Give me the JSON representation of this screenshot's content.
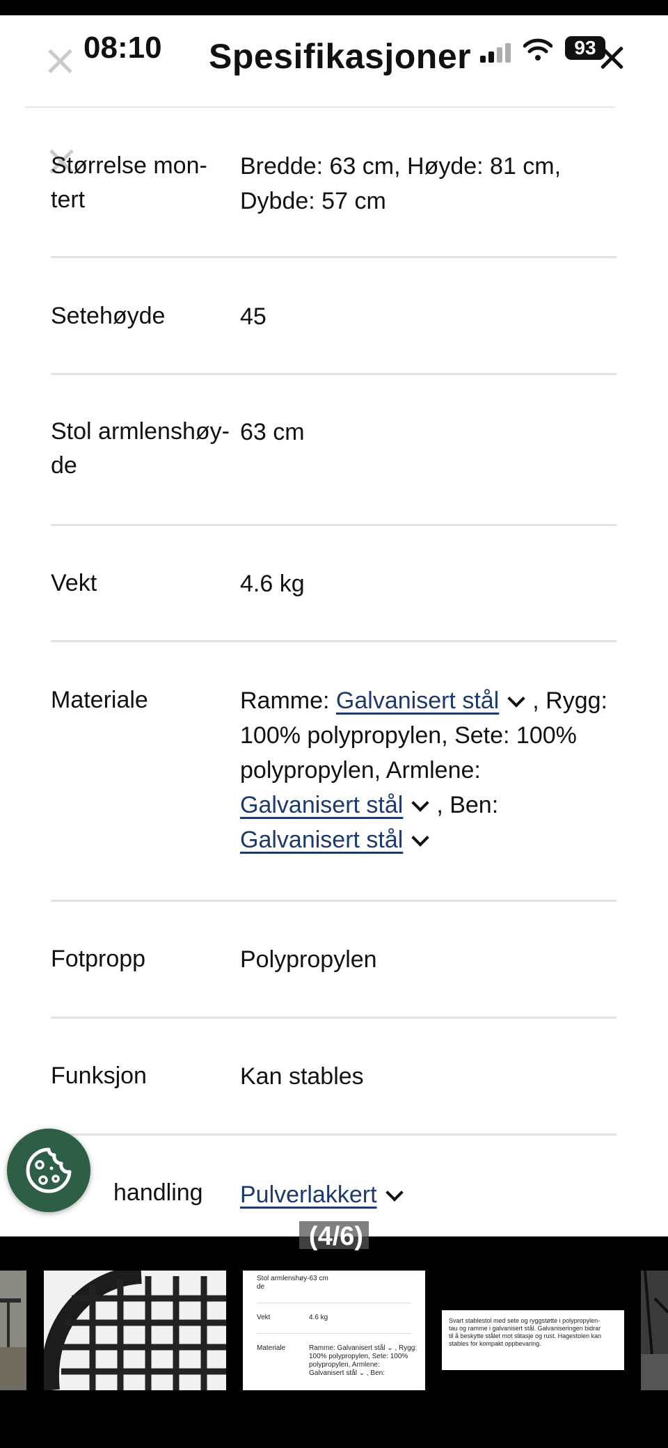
{
  "header": {
    "title": "Spesifikasjoner",
    "time": "08:10",
    "battery": "93"
  },
  "specs": [
    {
      "label": "Størrelse mon-tert",
      "label_lines": [
        "Størrelse mon-",
        "tert"
      ],
      "value_lines": [
        "Bredde: 63 cm, Høyde: 81 cm,",
        "Dybde: 57 cm"
      ]
    },
    {
      "label": "Setehøyde",
      "value": "45"
    },
    {
      "label_lines": [
        "Stol armlenshøy-",
        "de"
      ],
      "value": "63 cm"
    },
    {
      "label": "Vekt",
      "value": "4.6 kg"
    },
    {
      "label": "Materiale",
      "material": {
        "prefix": "Ramme: ",
        "link1": "Galvanisert stål",
        "after1": ", Rygg:",
        "line2": "100% polypropylen, Sete: 100%",
        "line3": "polypropylen, Armlene:",
        "link2": "Galvanisert stål",
        "after2": ", Ben:",
        "link3": "Galvanisert stål"
      }
    },
    {
      "label": "Fotpropp",
      "value": "Polypropylen"
    },
    {
      "label": "Funksjon",
      "value": "Kan stables"
    },
    {
      "label": "handling",
      "value_link": "Pulverlakkert"
    }
  ],
  "gallery": {
    "counter": "(4/6)",
    "thumb3": {
      "row1_label_lines": [
        "Stol armlenshøy-63 cm",
        "de"
      ],
      "row2_label": "Vekt",
      "row2_value": "4.6 kg",
      "row3_label": "Materiale",
      "row3_value_lines": [
        "Ramme: Galvanisert stål ⌄ , Rygg:",
        "100% polypropylen, Sete: 100%",
        "polypropylen, Armlene:",
        "Galvanisert stål ⌄ , Ben:"
      ]
    },
    "thumb4": {
      "lines": [
        "Svart stablestol med sete og ryggstøtte i polypropylen-",
        "tau og ramme i galvanisert stål. Galvaniseringen bidrar",
        "til å beskytte stålet mot slitasje og rust. Hagestolen kan",
        "stables for kompakt oppbevaring."
      ]
    }
  }
}
